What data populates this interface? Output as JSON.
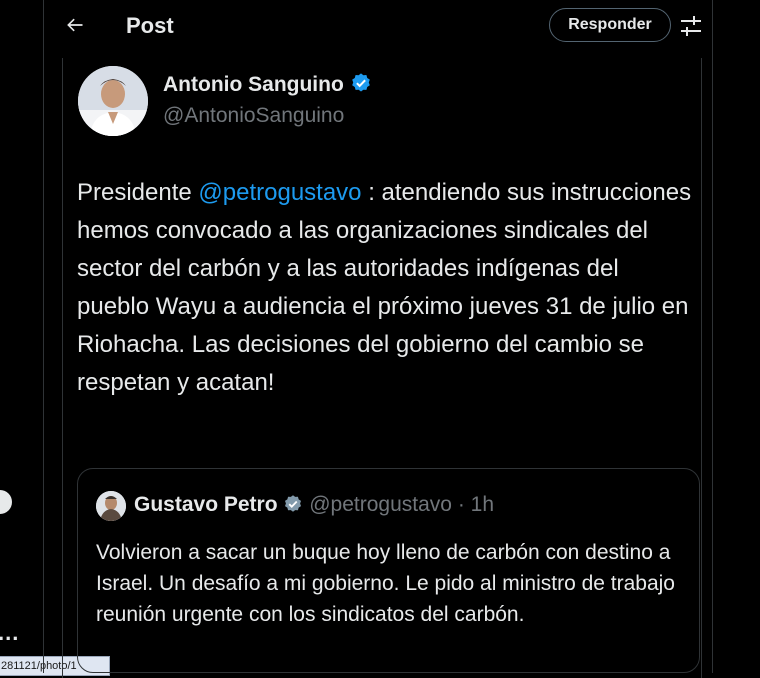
{
  "header": {
    "title": "Post",
    "reply_label": "Responder",
    "back_icon": "arrow-left-icon",
    "settings_icon": "sliders-icon"
  },
  "tweet": {
    "display_name": "Antonio Sanguino",
    "handle": "@AntonioSanguino",
    "verified": true,
    "text_prefix": "Presidente ",
    "mention": "@petrogustavo",
    "text_rest": " : atendiendo sus instrucciones hemos convocado a las organizaciones sindicales del sector del carbón y a las autoridades indígenas del pueblo Wayu a audiencia el próximo jueves 31 de julio en Riohacha. Las decisiones del gobierno del cambio se respetan y acatan!"
  },
  "quote": {
    "display_name": "Gustavo Petro",
    "handle": "@petrogustavo",
    "separator": "·",
    "time": "1h",
    "verified_color": "#829aab",
    "text": "Volvieron a sacar un buque hoy lleno de carbón con destino a Israel. Un desafío a mi gobierno. Le pido al ministro de trabajo reunión urgente con los sindicatos del carbón."
  },
  "sidebar": {
    "more": "..."
  },
  "status_url": "281121/photo/1",
  "colors": {
    "background": "#000000",
    "text": "#e7e9ea",
    "muted": "#71767b",
    "accent": "#1d9bf0",
    "border": "#2f3336"
  }
}
